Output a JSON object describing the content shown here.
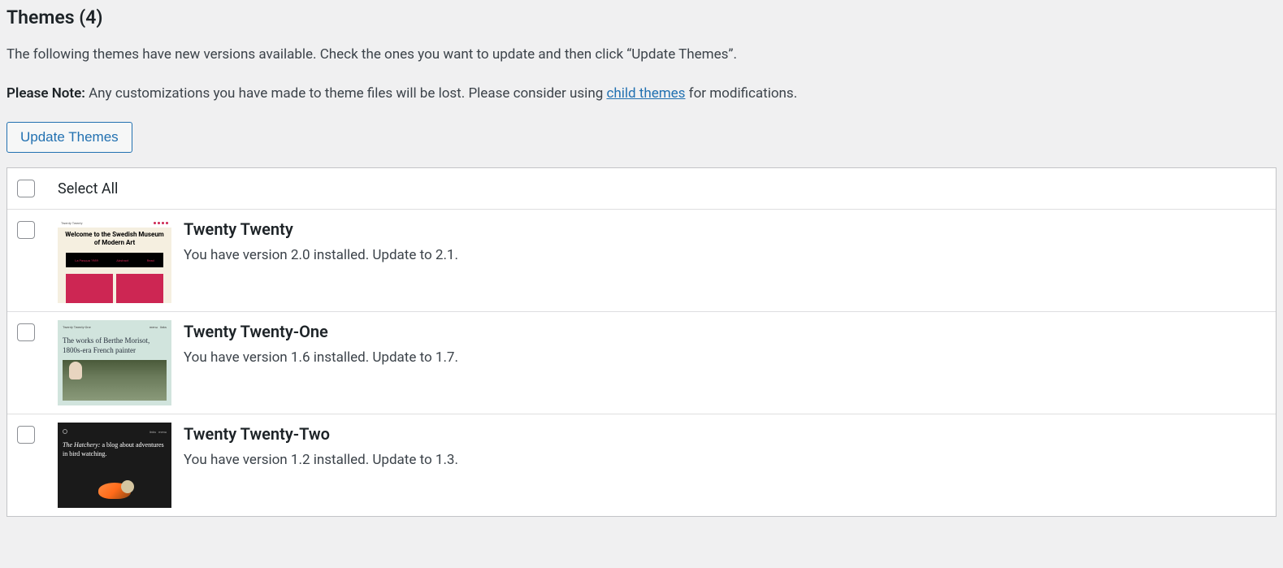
{
  "heading": "Themes (4)",
  "intro": "The following themes have new versions available. Check the ones you want to update and then click “Update Themes”.",
  "note": {
    "label": "Please Note:",
    "before_link": " Any customizations you have made to theme files will be lost. Please consider using ",
    "link_text": "child themes",
    "after_link": " for modifications."
  },
  "update_button": "Update Themes",
  "select_all": "Select All",
  "themes": [
    {
      "name": "Twenty Twenty",
      "version_text": "You have version 2.0 installed. Update to 2.1.",
      "thumb_heading": "Welcome to the Swedish Museum of Modern Art"
    },
    {
      "name": "Twenty Twenty-One",
      "version_text": "You have version 1.6 installed. Update to 1.7.",
      "thumb_heading": "The works of Berthe Morisot, 1800s-era French painter"
    },
    {
      "name": "Twenty Twenty-Two",
      "version_text": "You have version 1.2 installed. Update to 1.3.",
      "thumb_heading_italic": "The Hatchery:",
      "thumb_heading_rest": " a blog about adventures in bird watching."
    }
  ]
}
